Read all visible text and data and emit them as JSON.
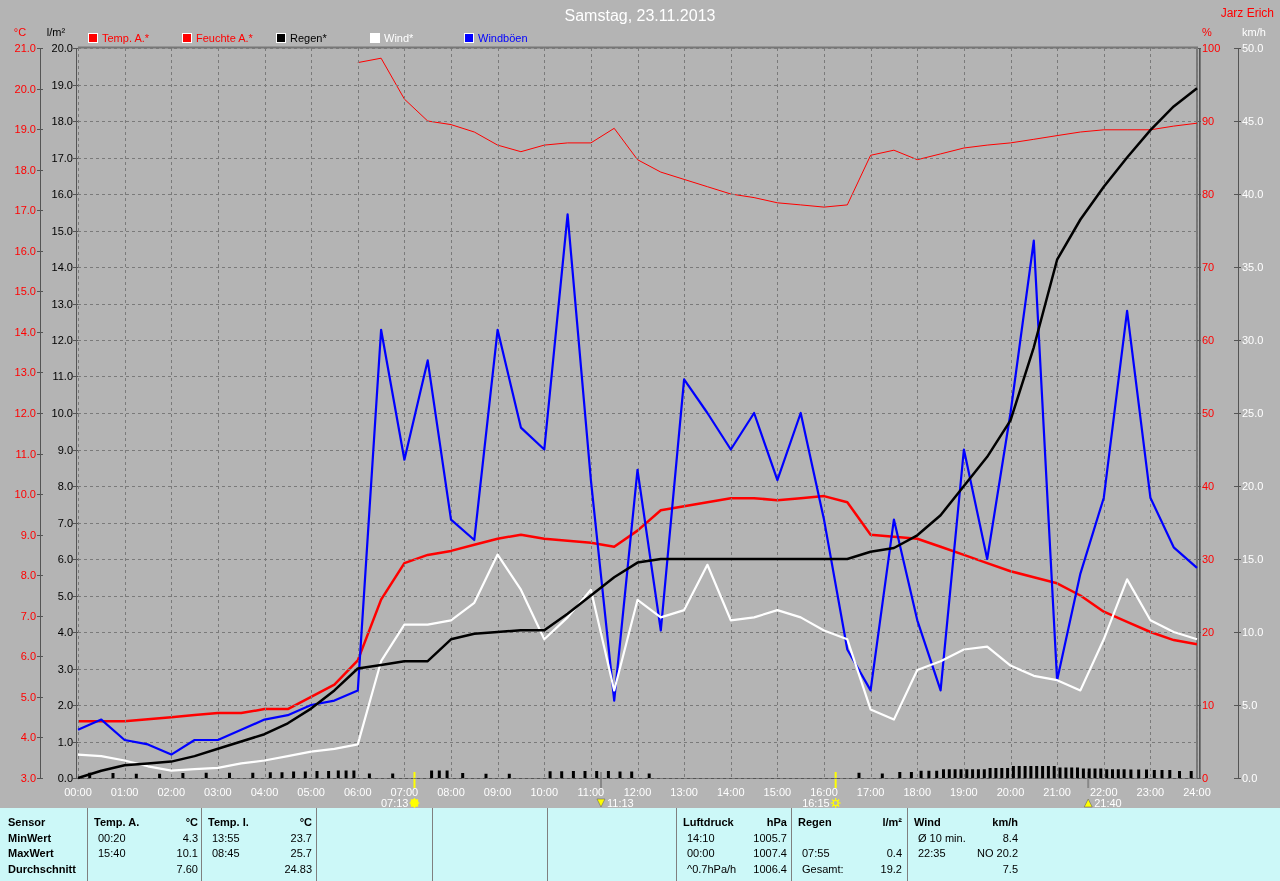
{
  "author": "Jarz Erich",
  "charts": [
    {
      "chart_data": {
        "type": "line",
        "title": "Samstag, 23.11.2013",
        "xlim": [
          0,
          24
        ],
        "x": [
          0,
          0.5,
          1,
          1.5,
          2,
          2.5,
          3,
          3.5,
          4,
          4.5,
          5,
          5.5,
          6,
          6.5,
          7,
          7.5,
          8,
          8.5,
          9,
          9.5,
          10,
          10.5,
          11,
          11.5,
          12,
          12.5,
          13,
          13.5,
          14,
          14.5,
          15,
          15.5,
          16,
          16.5,
          17,
          17.5,
          18,
          18.5,
          19,
          19.5,
          20,
          20.5,
          21,
          21.5,
          22,
          22.5,
          23,
          23.5,
          24
        ],
        "xticks": [
          {
            "value": 0,
            "label": "00:00"
          },
          {
            "value": 1,
            "label": "01:00"
          },
          {
            "value": 2,
            "label": "02:00"
          },
          {
            "value": 3,
            "label": "03:00"
          },
          {
            "value": 4,
            "label": "04:00"
          },
          {
            "value": 5,
            "label": "05:00"
          },
          {
            "value": 6,
            "label": "06:00"
          },
          {
            "value": 7,
            "label": "07:00"
          },
          {
            "value": 8,
            "label": "08:00"
          },
          {
            "value": 9,
            "label": "09:00"
          },
          {
            "value": 10,
            "label": "10:00"
          },
          {
            "value": 11,
            "label": "11:00"
          },
          {
            "value": 12,
            "label": "12:00"
          },
          {
            "value": 13,
            "label": "13:00"
          },
          {
            "value": 14,
            "label": "14:00"
          },
          {
            "value": 15,
            "label": "15:00"
          },
          {
            "value": 16,
            "label": "16:00"
          },
          {
            "value": 17,
            "label": "17:00"
          },
          {
            "value": 18,
            "label": "18:00"
          },
          {
            "value": 19,
            "label": "19:00"
          },
          {
            "value": 20,
            "label": "20:00"
          },
          {
            "value": 21,
            "label": "21:00"
          },
          {
            "value": 22,
            "label": "22:00"
          },
          {
            "value": 23,
            "label": "23:00"
          },
          {
            "value": 24,
            "label": "24:00"
          }
        ],
        "ylabel": "°C",
        "ylim": [
          3,
          21
        ],
        "yticks": [
          {
            "value": 3,
            "label": "3.0"
          },
          {
            "value": 4,
            "label": "4.0"
          },
          {
            "value": 5,
            "label": "5.0"
          },
          {
            "value": 6,
            "label": "6.0"
          },
          {
            "value": 7,
            "label": "7.0"
          },
          {
            "value": 8,
            "label": "8.0"
          },
          {
            "value": 9,
            "label": "9.0"
          },
          {
            "value": 10,
            "label": "10.0"
          },
          {
            "value": 11,
            "label": "11.0"
          },
          {
            "value": 12,
            "label": "12.0"
          },
          {
            "value": 13,
            "label": "13.0"
          },
          {
            "value": 14,
            "label": "14.0"
          },
          {
            "value": 15,
            "label": "15.0"
          },
          {
            "value": 16,
            "label": "16.0"
          },
          {
            "value": 17,
            "label": "17.0"
          },
          {
            "value": 18,
            "label": "18.0"
          },
          {
            "value": 19,
            "label": "19.0"
          },
          {
            "value": 20,
            "label": "20.0"
          },
          {
            "value": 21,
            "label": "21.0"
          }
        ],
        "y2label": "%",
        "y2lim": [
          0,
          100
        ],
        "y2ticks": [
          {
            "value": 0,
            "label": "0"
          },
          {
            "value": 10,
            "label": "10"
          },
          {
            "value": 20,
            "label": "20"
          },
          {
            "value": 30,
            "label": "30"
          },
          {
            "value": 40,
            "label": "40"
          },
          {
            "value": 50,
            "label": "50"
          },
          {
            "value": 60,
            "label": "60"
          },
          {
            "value": 70,
            "label": "70"
          },
          {
            "value": 80,
            "label": "80"
          },
          {
            "value": 90,
            "label": "90"
          },
          {
            "value": 100,
            "label": "100"
          }
        ],
        "series": [
          {
            "name": "Temp. A.*",
            "color": "#ff0000",
            "values": [
              4.4,
              4.4,
              4.4,
              4.45,
              4.5,
              4.55,
              4.6,
              4.6,
              4.7,
              4.7,
              5.0,
              5.3,
              5.9,
              7.4,
              8.3,
              8.5,
              8.6,
              8.75,
              8.9,
              9.0,
              8.9,
              8.85,
              8.8,
              8.7,
              9.1,
              9.6,
              9.7,
              9.8,
              9.9,
              9.9,
              9.85,
              9.9,
              9.95,
              9.8,
              9.0,
              8.95,
              8.9,
              8.7,
              8.5,
              8.3,
              8.1,
              7.95,
              7.8,
              7.5,
              7.1,
              6.85,
              6.6,
              6.4,
              6.3
            ]
          },
          {
            "name": "Feuchte A.*",
            "color": "#ff0000",
            "axis": "y2",
            "values": [
              null,
              null,
              null,
              null,
              null,
              null,
              null,
              null,
              null,
              null,
              null,
              null,
              98,
              98.6,
              93,
              90,
              89.5,
              88.5,
              86.7,
              85.8,
              86.7,
              87,
              87,
              89,
              84.7,
              83,
              82,
              81,
              80,
              79.5,
              78.8,
              78.5,
              78.2,
              78.5,
              85.3,
              86,
              84.7,
              85.5,
              86.3,
              86.7,
              87,
              87.5,
              88,
              88.5,
              88.8,
              88.8,
              88.8,
              89.3,
              89.7
            ]
          }
        ],
        "legend": "top",
        "annotations": [
          "07:13",
          "11:13",
          "16:15",
          "21:40"
        ]
      }
    },
    {
      "chart_data": {
        "type": "line",
        "xlim": [
          0,
          24
        ],
        "legend": "top",
        "grid": true,
        "x": [
          0,
          0.5,
          1,
          1.5,
          2,
          2.5,
          3,
          3.5,
          4,
          4.5,
          5,
          5.5,
          6,
          6.5,
          7,
          7.5,
          8,
          8.5,
          9,
          9.5,
          10,
          10.5,
          11,
          11.5,
          12,
          12.5,
          13,
          13.5,
          14,
          14.5,
          15,
          15.5,
          16,
          16.5,
          17,
          17.5,
          18,
          18.5,
          19,
          19.5,
          20,
          20.5,
          21,
          21.5,
          22,
          22.5,
          23,
          23.5,
          24
        ],
        "ylabel": "l/m²",
        "ylim": [
          0,
          20
        ],
        "yticks": [
          {
            "value": 0,
            "label": "0.0"
          },
          {
            "value": 1,
            "label": "1.0"
          },
          {
            "value": 2,
            "label": "2.0"
          },
          {
            "value": 3,
            "label": "3.0"
          },
          {
            "value": 4,
            "label": "4.0"
          },
          {
            "value": 5,
            "label": "5.0"
          },
          {
            "value": 6,
            "label": "6.0"
          },
          {
            "value": 7,
            "label": "7.0"
          },
          {
            "value": 8,
            "label": "8.0"
          },
          {
            "value": 9,
            "label": "9.0"
          },
          {
            "value": 10,
            "label": "10.0"
          },
          {
            "value": 11,
            "label": "11.0"
          },
          {
            "value": 12,
            "label": "12.0"
          },
          {
            "value": 13,
            "label": "13.0"
          },
          {
            "value": 14,
            "label": "14.0"
          },
          {
            "value": 15,
            "label": "15.0"
          },
          {
            "value": 16,
            "label": "16.0"
          },
          {
            "value": 17,
            "label": "17.0"
          },
          {
            "value": 18,
            "label": "18.0"
          },
          {
            "value": 19,
            "label": "19.0"
          },
          {
            "value": 20,
            "label": "20.0"
          }
        ],
        "y2label": "km/h",
        "y2lim": [
          0,
          50
        ],
        "y2ticks": [
          {
            "value": 0,
            "label": "0.0"
          },
          {
            "value": 5,
            "label": "5.0"
          },
          {
            "value": 10,
            "label": "10.0"
          },
          {
            "value": 15,
            "label": "15.0"
          },
          {
            "value": 20,
            "label": "20.0"
          },
          {
            "value": 25,
            "label": "25.0"
          },
          {
            "value": 30,
            "label": "30.0"
          },
          {
            "value": 35,
            "label": "35.0"
          },
          {
            "value": 40,
            "label": "40.0"
          },
          {
            "value": 45,
            "label": "45.0"
          },
          {
            "value": 50,
            "label": "50.0"
          }
        ],
        "series": [
          {
            "name": "Regen*",
            "color": "#000000",
            "values": [
              0,
              0.2,
              0.35,
              0.4,
              0.45,
              0.6,
              0.8,
              1.0,
              1.2,
              1.5,
              1.9,
              2.4,
              3.0,
              3.1,
              3.2,
              3.2,
              3.8,
              3.95,
              4.0,
              4.05,
              4.05,
              4.5,
              5.0,
              5.5,
              5.9,
              6.0,
              6.0,
              6.0,
              6.0,
              6.0,
              6.0,
              6.0,
              6.0,
              6.0,
              6.2,
              6.3,
              6.65,
              7.2,
              8.0,
              8.8,
              9.8,
              11.8,
              14.2,
              15.3,
              16.2,
              17.0,
              17.75,
              18.4,
              18.9
            ]
          },
          {
            "name": "Wind*",
            "color": "#ffffff",
            "axis": "y2",
            "values": [
              1.6,
              1.5,
              1.2,
              0.8,
              0.5,
              0.6,
              0.7,
              1.0,
              1.2,
              1.5,
              1.8,
              2.0,
              2.3,
              8.0,
              10.5,
              10.5,
              10.8,
              12.0,
              15.3,
              12.9,
              9.5,
              11.0,
              12.9,
              6.0,
              12.2,
              11.0,
              11.5,
              14.6,
              10.8,
              11.0,
              11.5,
              11.0,
              10.1,
              9.5,
              4.7,
              4.0,
              7.4,
              8.0,
              8.8,
              9.0,
              7.7,
              7.0,
              6.7,
              6.0,
              9.5,
              13.6,
              10.8,
              10.0,
              9.5
            ]
          },
          {
            "name": "Windböen",
            "color": "#0000ff",
            "axis": "y2",
            "values": [
              3.3,
              4.0,
              2.6,
              2.3,
              1.6,
              2.6,
              2.6,
              3.3,
              4.0,
              4.3,
              5.0,
              5.3,
              6.0,
              30.7,
              21.8,
              28.6,
              17.7,
              16.3,
              30.7,
              24.0,
              22.5,
              38.6,
              20.4,
              5.3,
              21.1,
              10.1,
              27.3,
              25.0,
              22.5,
              25.0,
              20.4,
              25.0,
              17.7,
              8.8,
              6.0,
              17.7,
              10.8,
              6.0,
              22.5,
              15.0,
              25.0,
              36.8,
              6.7,
              14.0,
              19.2,
              32.0,
              19.2,
              15.8,
              14.4
            ]
          }
        ]
      }
    }
  ],
  "event_icons": [
    {
      "kind": "sunrise"
    },
    {
      "kind": "moonset"
    },
    {
      "kind": "sunset"
    },
    {
      "kind": "moonrise"
    }
  ],
  "stats": {
    "row_labels": [
      "Sensor",
      "MinWert",
      "MaxWert",
      "Durchschnitt"
    ],
    "columns": [
      {
        "kind": "sensor",
        "title": "Temp. A.",
        "unit": "°C",
        "rows": [
          {
            "time": "00:20",
            "value": "4.3"
          },
          {
            "time": "15:40",
            "value": "10.1"
          },
          {
            "value": "7.60"
          }
        ]
      },
      {
        "kind": "sensor",
        "title": "Temp. I.",
        "unit": "°C",
        "rows": [
          {
            "time": "13:55",
            "value": "23.7"
          },
          {
            "time": "08:45",
            "value": "25.7"
          },
          {
            "value": "24.83"
          }
        ]
      },
      {
        "kind": "blank"
      },
      {
        "kind": "blank"
      },
      {
        "kind": "blank"
      },
      {
        "kind": "sensor",
        "title": "Luftdruck",
        "unit": "hPa",
        "rows": [
          {
            "time": "14:10",
            "value": "1005.7"
          },
          {
            "time": "00:00",
            "value": "1007.4"
          },
          {
            "time": "^0.7hPa/h",
            "value": "1006.4"
          }
        ]
      },
      {
        "kind": "sensor",
        "title": "Regen",
        "unit": "l/m²",
        "rows": [
          null,
          {
            "time": "07:55",
            "value": "0.4"
          },
          {
            "time": "Gesamt:",
            "value": "19.2"
          }
        ]
      },
      {
        "kind": "sensor",
        "title": "Wind",
        "unit": "km/h",
        "rows": [
          {
            "time": "Ø 10 min.",
            "value": "8.4"
          },
          {
            "time": "22:35",
            "value": "NO 20.2"
          },
          {
            "value": "7.5"
          }
        ]
      }
    ]
  }
}
